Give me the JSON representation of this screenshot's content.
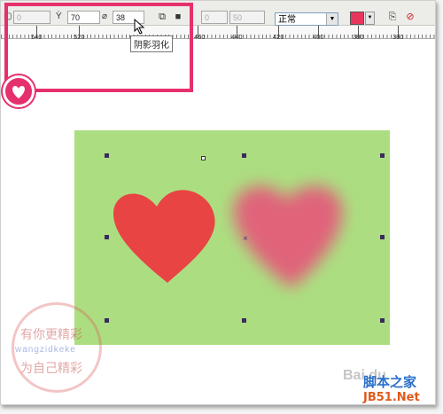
{
  "toolbar": {
    "offset_value": "0",
    "opacity_value": "70",
    "feather_value": "38",
    "field4_value": "0",
    "field5_value": "50",
    "merge_mode": "正常",
    "shadow_color": "#e8355d"
  },
  "tooltip": {
    "text": "阴影羽化"
  },
  "ruler": {
    "ticks": [
      "540",
      "520",
      "460",
      "440",
      "420",
      "400",
      "380",
      "360"
    ]
  },
  "canvas": {
    "background": "#acde81",
    "heart_solid_color": "#e84444",
    "heart_blur_color": "#e0637a"
  },
  "watermark": {
    "line1": "有你更精彩",
    "line2": "wangzidkeke",
    "line3": "为自己精彩"
  },
  "logos": {
    "baidu": "Bai du",
    "site_cn": "脚本之家",
    "site_en": "JB51.Net"
  },
  "icons": {
    "opacity": "goblet-icon",
    "feather": "pen-icon",
    "direction": "direction-icon",
    "color": "color-picker-icon",
    "copy": "copy-shadow-icon",
    "clear": "clear-shadow-icon",
    "badge": "heart-icon"
  }
}
